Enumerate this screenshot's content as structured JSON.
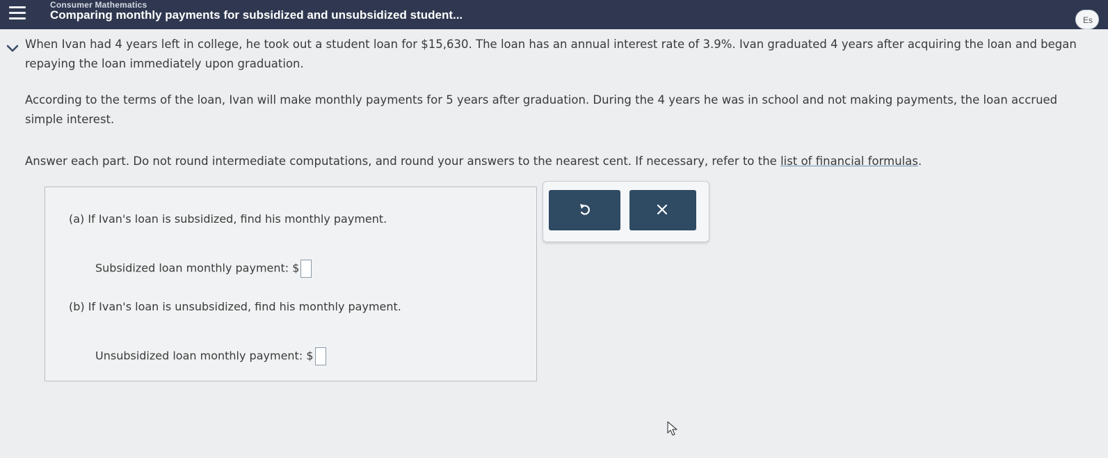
{
  "header": {
    "breadcrumb": "Consumer Mathematics",
    "title": "Comparing monthly payments for subsidized and unsubsidized student...",
    "language_label": "Es"
  },
  "problem": {
    "paragraph1": "When Ivan had 4 years left in college, he took out a student loan for $15,630. The loan has an annual interest rate of 3.9%. Ivan graduated 4 years after acquiring the loan and began repaying the loan immediately upon graduation.",
    "paragraph2": "According to the terms of the loan, Ivan will make monthly payments for 5 years after graduation. During the 4 years he was in school and not making payments, the loan accrued simple interest.",
    "paragraph3_text": "Answer each part. Do not round intermediate computations, and round your answers to the nearest cent. If necessary, refer to the ",
    "paragraph3_link": "list of financial formulas",
    "paragraph3_end": "."
  },
  "answer": {
    "part_a_prompt": "(a) If Ivan's loan is subsidized, find his monthly payment.",
    "part_a_label": "Subsidized loan monthly payment:",
    "part_a_value": "",
    "part_b_prompt": "(b) If Ivan's loan is unsubsidized, find his monthly payment.",
    "part_b_label": "Unsubsidized loan monthly payment:",
    "part_b_value": "",
    "currency_symbol": "$"
  },
  "tools": {
    "undo_icon": "undo-icon",
    "clear_icon": "close-icon"
  },
  "colors": {
    "header_bg": "#2f3850",
    "tool_button_bg": "#2f4a63"
  }
}
